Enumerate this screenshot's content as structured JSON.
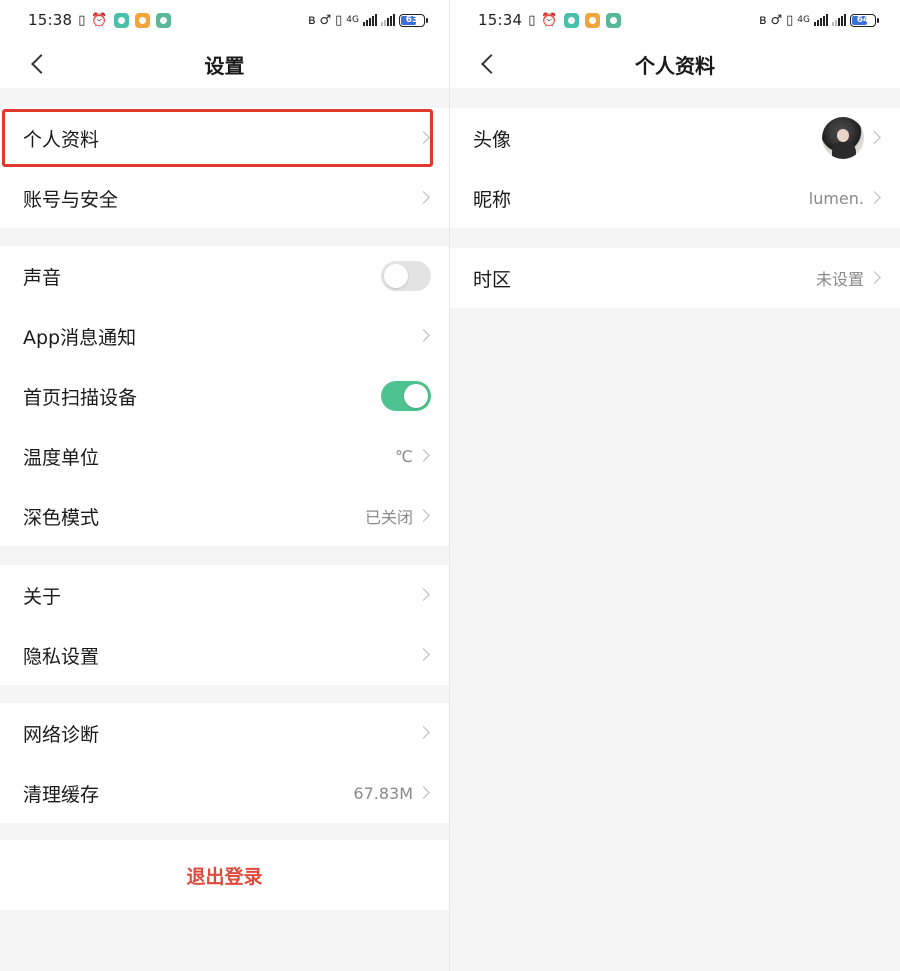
{
  "left": {
    "status": {
      "time": "15:38",
      "battery": "63",
      "net": "4G"
    },
    "title": "设置",
    "groups": [
      [
        {
          "label": "个人资料",
          "value": ""
        },
        {
          "label": "账号与安全",
          "value": ""
        }
      ],
      [
        {
          "label": "声音",
          "toggle": "off"
        },
        {
          "label": "App消息通知",
          "value": ""
        },
        {
          "label": "首页扫描设备",
          "toggle": "on"
        },
        {
          "label": "温度单位",
          "value": "℃"
        },
        {
          "label": "深色模式",
          "value": "已关闭"
        }
      ],
      [
        {
          "label": "关于",
          "value": ""
        },
        {
          "label": "隐私设置",
          "value": ""
        }
      ],
      [
        {
          "label": "网络诊断",
          "value": ""
        },
        {
          "label": "清理缓存",
          "value": "67.83M"
        }
      ]
    ],
    "logout": "退出登录"
  },
  "right": {
    "status": {
      "time": "15:34",
      "battery": "64",
      "net": "4G"
    },
    "title": "个人资料",
    "rows": [
      {
        "label": "头像"
      },
      {
        "label": "昵称",
        "value": "lumen."
      },
      {
        "label": "时区",
        "value": "未设置"
      }
    ]
  },
  "colors": {
    "accent_green": "#4ec38f",
    "highlight_red": "#e03a2c",
    "logout_red": "#e04a3c"
  }
}
